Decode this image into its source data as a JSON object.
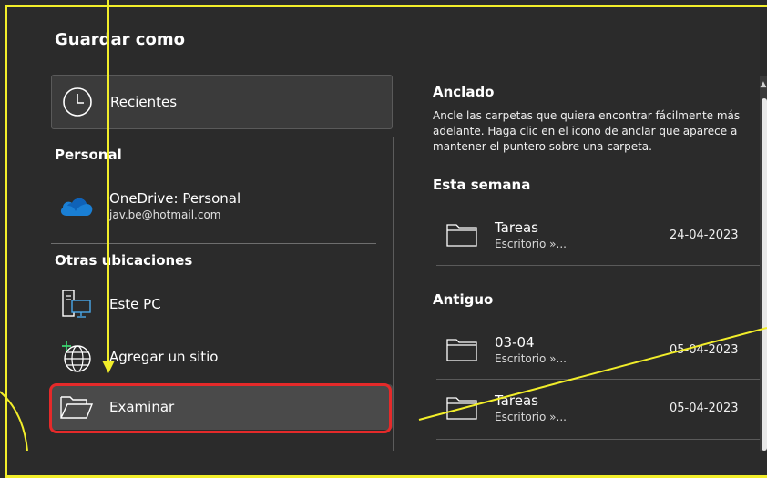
{
  "dialog": {
    "title": "Guardar como"
  },
  "left": {
    "recent_label": "Recientes",
    "personal_heading": "Personal",
    "onedrive": {
      "name": "OneDrive: Personal",
      "email": "jav.be@hotmail.com"
    },
    "other_heading": "Otras ubicaciones",
    "this_pc_label": "Este PC",
    "add_site_label": "Agregar un sitio",
    "browse_label": "Examinar"
  },
  "right": {
    "pinned_heading": "Anclado",
    "pinned_desc": "Ancle las carpetas que quiera encontrar fácilmente más adelante. Haga clic en el icono de anclar que aparece a mantener el puntero sobre una carpeta.",
    "week_heading": "Esta semana",
    "old_heading": "Antiguo",
    "week_items": [
      {
        "name": "Tareas",
        "path": "Escritorio »...",
        "date": "24-04-2023"
      }
    ],
    "old_items": [
      {
        "name": "03-04",
        "path": "Escritorio »...",
        "date": "05-04-2023"
      },
      {
        "name": "Tareas",
        "path": "Escritorio »...",
        "date": "05-04-2023"
      }
    ]
  },
  "colors": {
    "background": "#2b2b2b",
    "annotation_yellow": "#f2ee2a",
    "highlight_red": "#e52a2a",
    "onedrive_blue": "#1a7fd4"
  },
  "icons": {
    "recent": "clock-icon",
    "onedrive": "cloud-icon",
    "this_pc": "computer-icon",
    "add_site": "globe-plus-icon",
    "browse": "open-folder-icon",
    "folder": "folder-icon"
  }
}
